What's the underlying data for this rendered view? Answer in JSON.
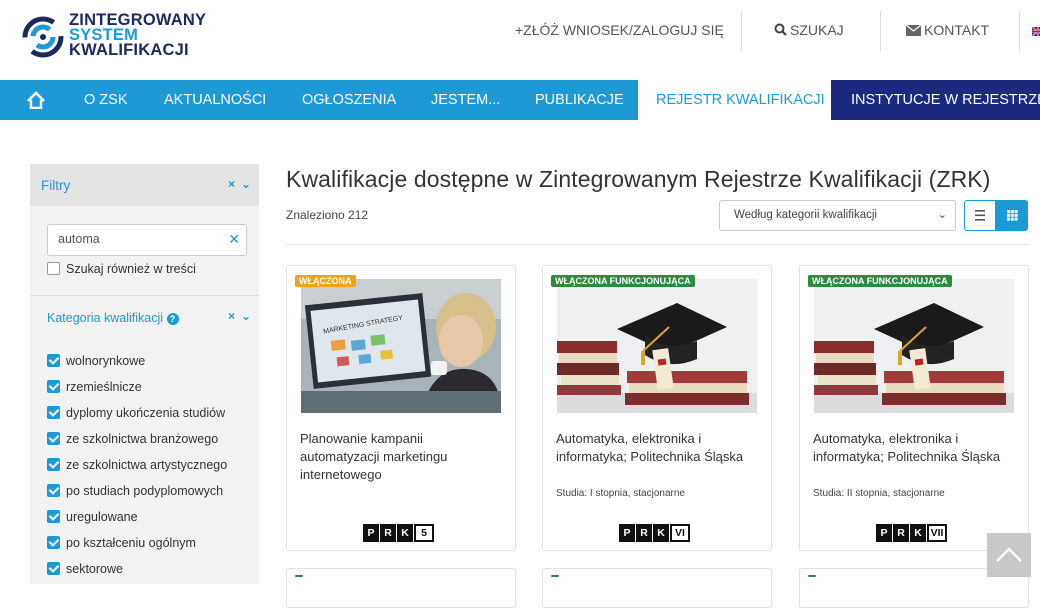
{
  "brand": {
    "line1": "ZINTEGROWANY",
    "line2": "SYSTEM",
    "line3": "KWALIFIKACJI",
    "colors": {
      "navy": "#1b2a5e",
      "blue": "#1d9ad6",
      "darknav": "#1b2a7e"
    }
  },
  "topbar": {
    "apply_login": "+ZŁÓŻ WNIOSEK/ZALOGUJ SIĘ",
    "search": "SZUKAJ",
    "contact": "KONTAKT",
    "search_icon": "search-icon",
    "mail_icon": "envelope-icon",
    "flag_icon": "uk-flag-icon"
  },
  "nav": {
    "home_icon": "home-icon",
    "items": [
      {
        "label": "O ZSK"
      },
      {
        "label": "AKTUALNOŚCI"
      },
      {
        "label": "OGŁOSZENIA"
      },
      {
        "label": "JESTEM..."
      },
      {
        "label": "PUBLIKACJE"
      },
      {
        "label": "REJESTR KWALIFIKACJI"
      },
      {
        "label": "INSTYTUCJE W REJESTRZE"
      }
    ]
  },
  "filters": {
    "title": "Filtry",
    "search_value": "automa",
    "search_in_content": "Szukaj również w treści",
    "category_title": "Kategoria kwalifikacji",
    "categories": [
      {
        "label": "wolnorynkowe",
        "checked": true
      },
      {
        "label": "rzemieślnicze",
        "checked": true
      },
      {
        "label": "dyplomy ukończenia studiów",
        "checked": true
      },
      {
        "label": "ze szkolnictwa branżowego",
        "checked": true
      },
      {
        "label": "ze szkolnictwa artystycznego",
        "checked": true
      },
      {
        "label": "po studiach podyplomowych",
        "checked": true
      },
      {
        "label": "uregulowane",
        "checked": true
      },
      {
        "label": "po kształceniu ogólnym",
        "checked": true
      },
      {
        "label": "sektorowe",
        "checked": true
      }
    ]
  },
  "main": {
    "title": "Kwalifikacje dostępne w Zintegrowanym Rejestrze Kwalifikacji (ZRK)",
    "found": "Znaleziono 212",
    "sort_value": "Według kategorii kwalifikacji",
    "view_list_icon": "list-view-icon",
    "view_grid_icon": "grid-view-icon"
  },
  "cards": [
    {
      "badge": "WŁĄCZONA",
      "badge_color": "#f0a41c",
      "image_text": "MARKETING STRATEGY",
      "title": "Planowanie kampanii automatyzacji marketingu internetowego",
      "subtitle": "",
      "prk_letters": [
        "P",
        "R",
        "K"
      ],
      "prk_level": "5"
    },
    {
      "badge": "WŁĄCZONA FUNKCJONUJĄCA",
      "badge_color": "#2d8a3e",
      "title": "Automatyka, elektronika i informatyka; Politechnika Śląska",
      "subtitle": "Studia: I stopnia, stacjonarne",
      "prk_letters": [
        "P",
        "R",
        "K"
      ],
      "prk_level": "VI"
    },
    {
      "badge": "WŁĄCZONA FUNKCJONUJĄCA",
      "badge_color": "#2d8a3e",
      "title": "Automatyka, elektronika i informatyka; Politechnika Śląska",
      "subtitle": "Studia: II stopnia, stacjonarne",
      "prk_letters": [
        "P",
        "R",
        "K"
      ],
      "prk_level": "VII"
    }
  ],
  "scroll_top_icon": "chevron-up-icon"
}
